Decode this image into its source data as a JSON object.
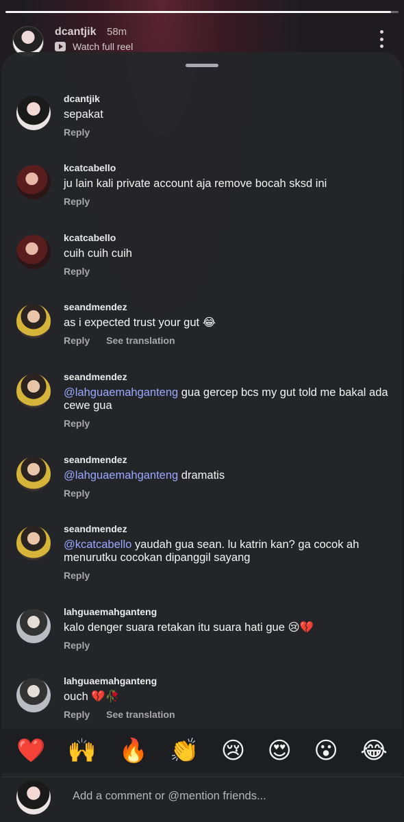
{
  "reel": {
    "username": "dcantjik",
    "time": "58m",
    "watch_label": "Watch full reel",
    "progress": 0.98
  },
  "comments": [
    {
      "user": "dcantjik",
      "text": "sepakat",
      "reply": "Reply"
    },
    {
      "user": "kcatcabello",
      "text": "ju lain kali private account aja remove bocah sksd ini",
      "reply": "Reply"
    },
    {
      "user": "kcatcabello",
      "text": "cuih cuih cuih",
      "reply": "Reply"
    },
    {
      "user": "seandmendez",
      "text": "as i expected trust your gut 😂",
      "reply": "Reply",
      "see_translation": "See translation"
    },
    {
      "user": "seandmendez",
      "mention": "@lahguaemahganteng",
      "text": " gua gercep bcs my gut told me bakal ada cewe gua",
      "reply": "Reply"
    },
    {
      "user": "seandmendez",
      "mention": "@lahguaemahganteng",
      "text": " dramatis",
      "reply": "Reply"
    },
    {
      "user": "seandmendez",
      "mention": "@kcatcabello",
      "text": " yaudah gua sean. lu katrin kan? ga cocok ah menurutku cocokan dipanggil sayang",
      "reply": "Reply"
    },
    {
      "user": "lahguaemahganteng",
      "text": "kalo denger suara retakan itu suara hati gue 😢💔",
      "reply": "Reply"
    },
    {
      "user": "lahguaemahganteng",
      "text": "ouch 💔🥀",
      "reply": "Reply",
      "see_translation": "See translation"
    }
  ],
  "reactions": [
    "❤️",
    "🙌",
    "🔥",
    "👏",
    "😢",
    "😍",
    "😮",
    "😂"
  ],
  "composer": {
    "placeholder": "Add a comment or @mention friends..."
  },
  "icons": {
    "play": "play-icon",
    "more": "more-vertical-icon"
  },
  "colors": {
    "mention": "#9aa8ff",
    "sheet": "#24252a"
  }
}
